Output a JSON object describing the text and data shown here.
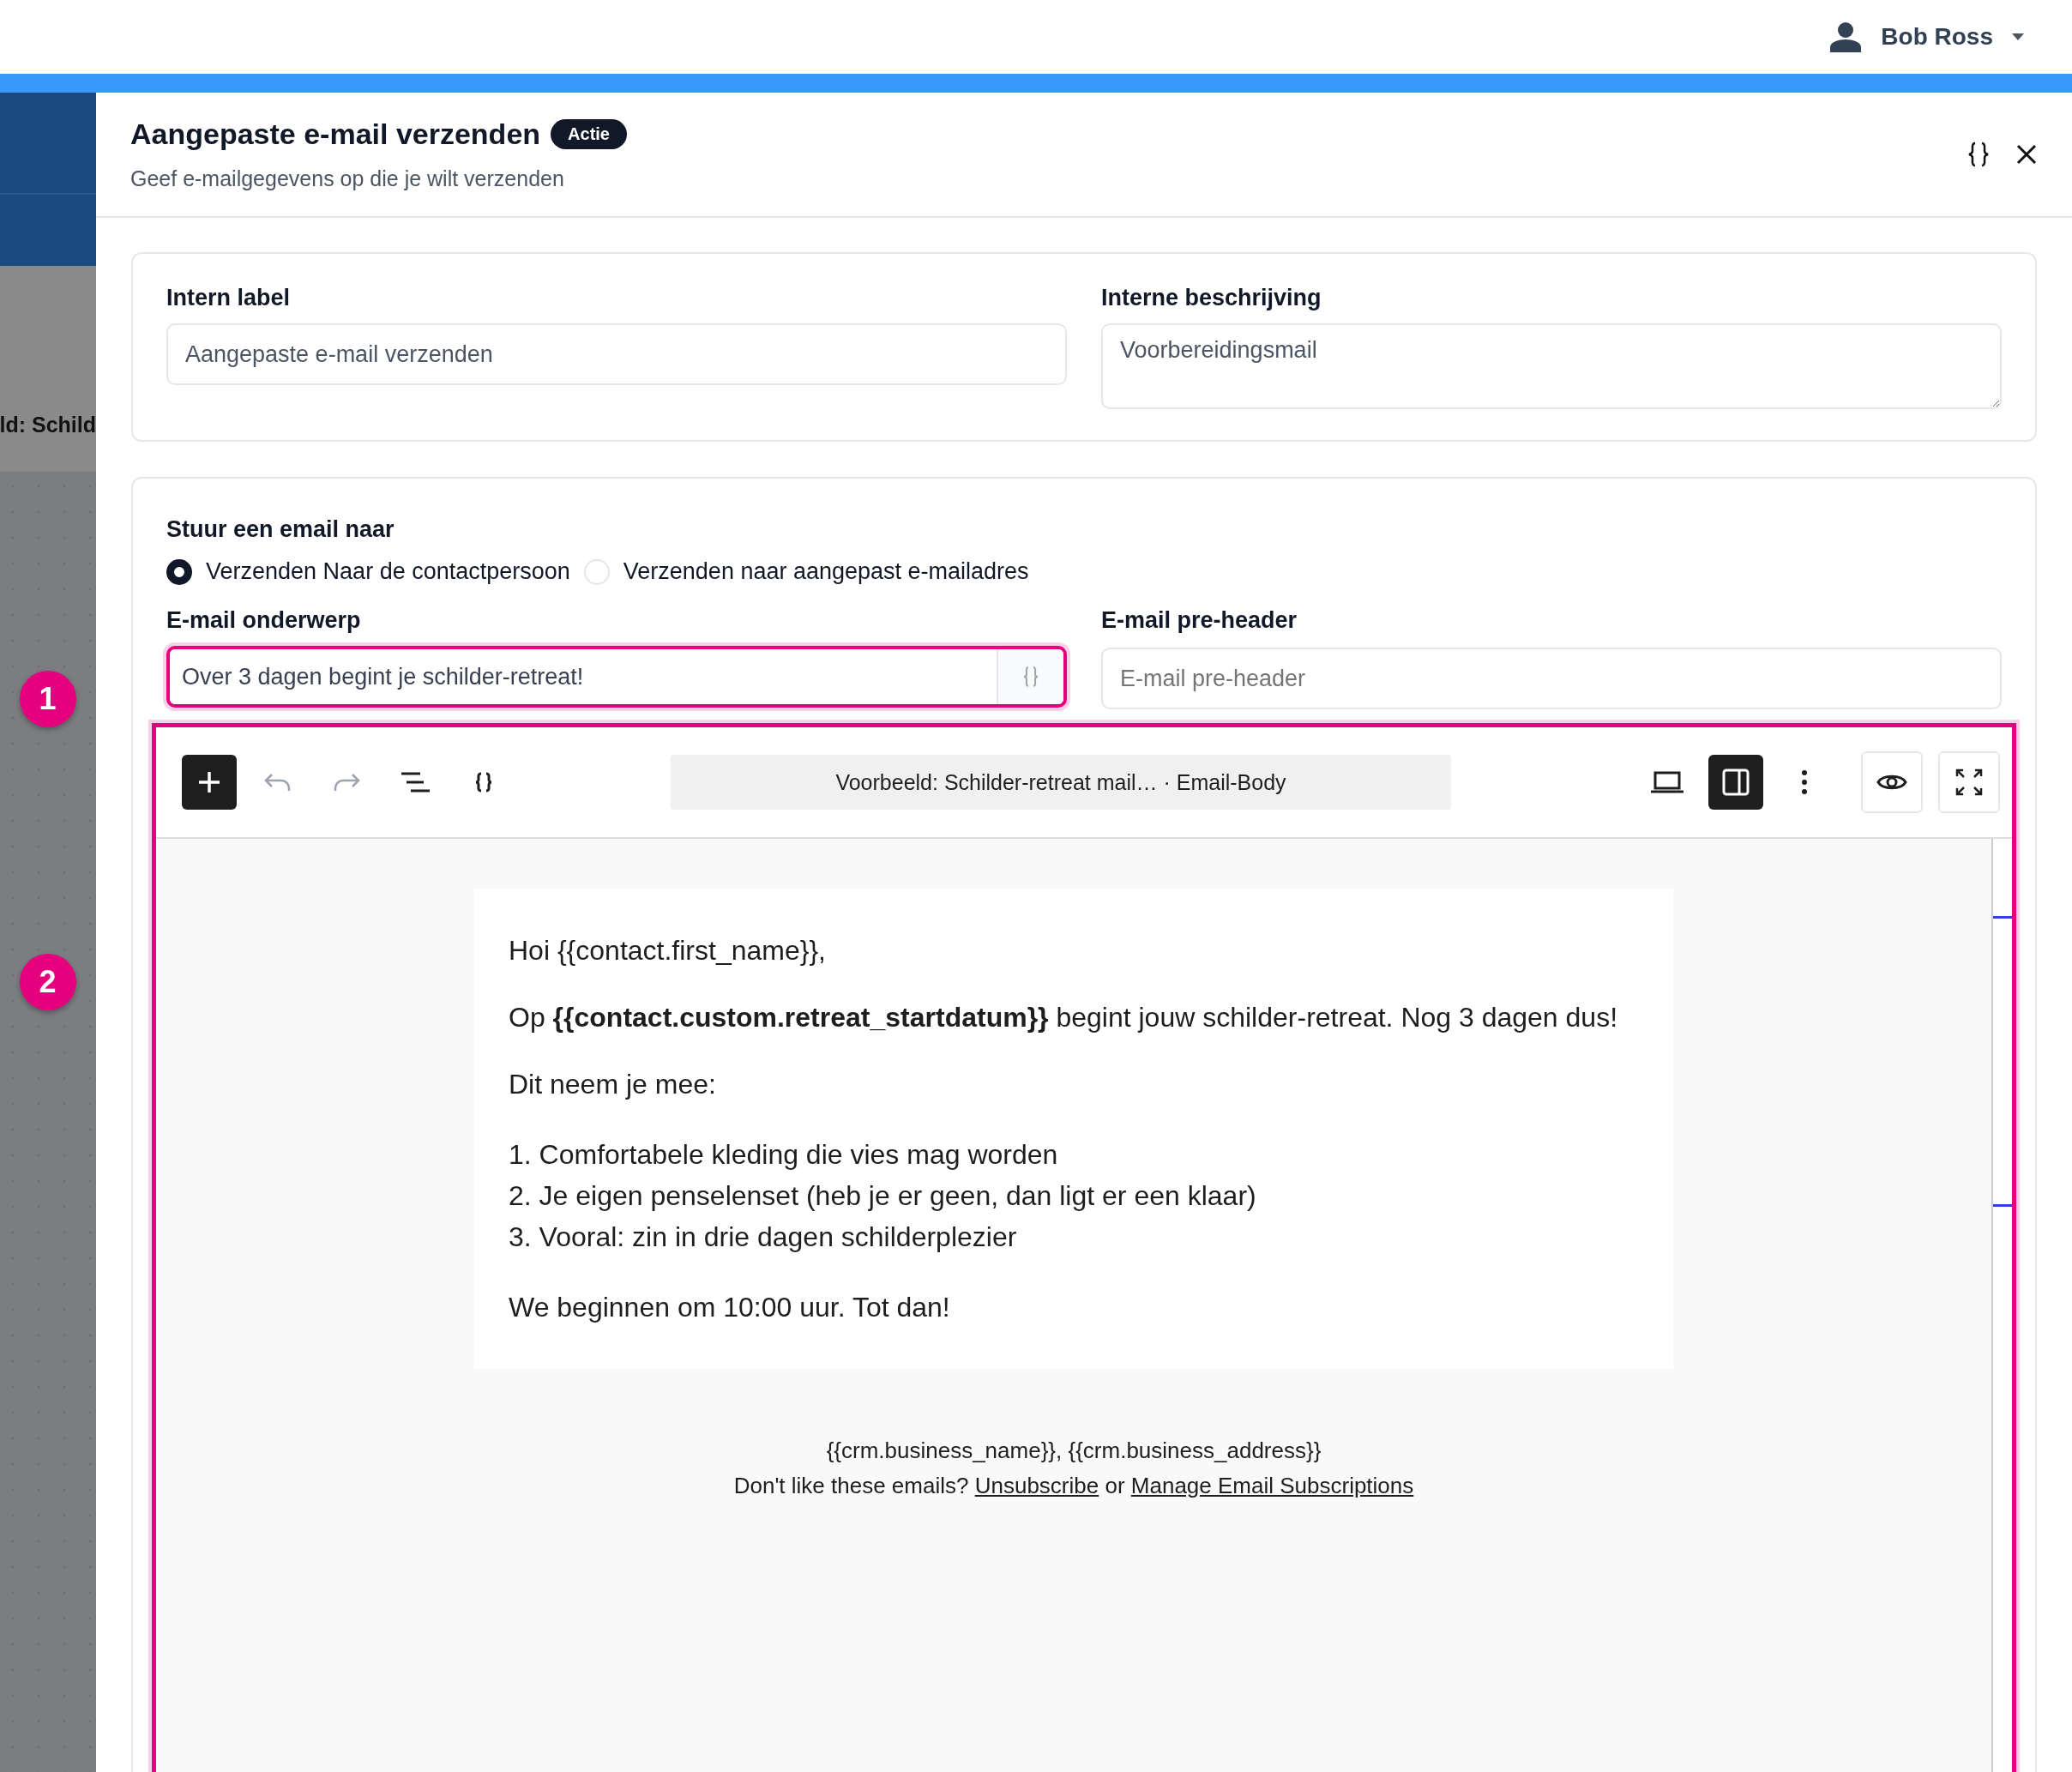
{
  "user_menu": {
    "name": "Bob Ross"
  },
  "background": {
    "partial_text": "ld: Schild",
    "step_badges": [
      "1",
      "2"
    ]
  },
  "panel": {
    "title": "Aangepaste e-mail verzenden",
    "badge": "Actie",
    "subtitle": "Geef e-mailgegevens op die je wilt verzenden"
  },
  "internal": {
    "label_field": {
      "label": "Intern label",
      "value": "Aangepaste e-mail verzenden"
    },
    "description_field": {
      "label": "Interne beschrijving",
      "value": "Voorbereidingsmail"
    }
  },
  "recipient": {
    "label": "Stuur een email naar",
    "options": [
      {
        "label": "Verzenden Naar de contactpersoon",
        "selected": true
      },
      {
        "label": "Verzenden naar aangepast e-mailadres",
        "selected": false
      }
    ]
  },
  "subject": {
    "label": "E-mail onderwerp",
    "value": "Over 3 dagen begint je schilder-retreat!",
    "highlighted": true
  },
  "preheader": {
    "label": "E-mail pre-header",
    "placeholder": "E-mail pre-header"
  },
  "editor": {
    "highlighted": true,
    "undo_disabled": true,
    "redo_disabled": true,
    "panel_toggle_on": true,
    "breadcrumb": "Voorbeeld: Schilder-retreat mail…",
    "breadcrumb_section": "· Email-Body",
    "email_paragraphs": [
      "Hoi {{contact.first_name}},",
      "Op **{{contact.custom.retreat_startdatum}}** begint jouw schilder-retreat. Nog 3 dagen dus!",
      "Dit neem je mee:"
    ],
    "email_list": [
      "1. Comfortabele kleding die vies mag worden",
      "2. Je eigen penselenset (heb je er geen, dan ligt er een klaar)",
      "3. Vooral: zin in drie dagen schilderplezier"
    ],
    "email_closing": "We beginnen om 10:00 uur. Tot dan!",
    "footer_address": "{{crm.business_name}}, {{crm.business_address}}",
    "footer_notice": {
      "before": "Don't like these emails?",
      "link1": "Unsubscribe",
      "between": "or",
      "link2": "Manage Email Subscriptions"
    }
  }
}
